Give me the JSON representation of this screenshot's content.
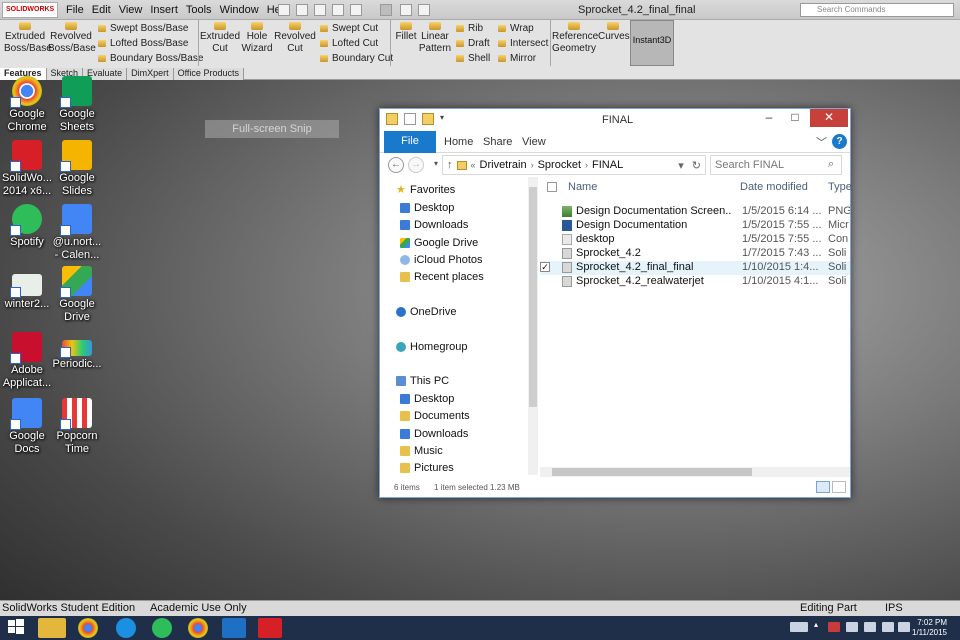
{
  "solidworks": {
    "logo": "SOLIDWORKS",
    "menu": [
      "File",
      "Edit",
      "View",
      "Insert",
      "Tools",
      "Window",
      "Help"
    ],
    "doc_title": "Sprocket_4.2_final_final",
    "search_placeholder": "Search Commands",
    "commands": {
      "extruded_boss": "Extruded\nBoss/Base",
      "revolved_boss": "Revolved\nBoss/Base",
      "swept_boss": "Swept Boss/Base",
      "lofted_boss": "Lofted Boss/Base",
      "boundary_boss": "Boundary Boss/Base",
      "extruded_cut": "Extruded\nCut",
      "hole_wizard": "Hole\nWizard",
      "revolved_cut": "Revolved\nCut",
      "swept_cut": "Swept Cut",
      "lofted_cut": "Lofted Cut",
      "boundary_cut": "Boundary Cut",
      "fillet": "Fillet",
      "linear_pattern": "Linear\nPattern",
      "rib": "Rib",
      "draft": "Draft",
      "shell": "Shell",
      "wrap": "Wrap",
      "intersect": "Intersect",
      "mirror": "Mirror",
      "reference_geometry": "Reference\nGeometry",
      "curves": "Curves",
      "instant3d": "Instant3D"
    },
    "tabs": [
      "Features",
      "Sketch",
      "Evaluate",
      "DimXpert",
      "Office Products"
    ],
    "status_left": "SolidWorks Student Edition",
    "status_mid": "Academic Use Only",
    "status_right": "Editing Part",
    "status_units": "IPS"
  },
  "desktop": {
    "snip_label": "Full-screen Snip",
    "icons": [
      {
        "label": "Google\nChrome"
      },
      {
        "label": "Google\nSheets"
      },
      {
        "label": "SolidWo...\n2014 x6..."
      },
      {
        "label": "Google\nSlides"
      },
      {
        "label": "Spotify"
      },
      {
        "label": "@u.nort...\n- Calen..."
      },
      {
        "label": "winter2..."
      },
      {
        "label": "Google\nDrive"
      },
      {
        "label": "Adobe\nApplicat..."
      },
      {
        "label": "Periodic..."
      },
      {
        "label": "Google\nDocs"
      },
      {
        "label": "Popcorn\nTime"
      }
    ]
  },
  "explorer": {
    "title": "FINAL",
    "ribbon": {
      "file": "File",
      "home": "Home",
      "share": "Share",
      "view": "View",
      "help": "?"
    },
    "breadcrumb": [
      "Drivetrain",
      "Sprocket",
      "FINAL"
    ],
    "breadcrumb_prefix": "«",
    "search_placeholder": "Search FINAL",
    "nav": {
      "favorites": "Favorites",
      "fav_items": [
        "Desktop",
        "Downloads",
        "Google Drive",
        "iCloud Photos",
        "Recent places"
      ],
      "onedrive": "OneDrive",
      "homegroup": "Homegroup",
      "thispc": "This PC",
      "pc_items": [
        "Desktop",
        "Documents",
        "Downloads",
        "Music",
        "Pictures"
      ]
    },
    "columns": {
      "name": "Name",
      "date": "Date modified",
      "type": "Type"
    },
    "files": [
      {
        "name": "Design Documentation Screen...",
        "date": "1/5/2015 6:14 ...",
        "type": "PNG"
      },
      {
        "name": "Design Documentation",
        "date": "1/5/2015 7:55 ...",
        "type": "Micr"
      },
      {
        "name": "desktop",
        "date": "1/5/2015 7:55 ...",
        "type": "Con"
      },
      {
        "name": "Sprocket_4.2",
        "date": "1/7/2015 7:43 ...",
        "type": "Soli"
      },
      {
        "name": "Sprocket_4.2_final_final",
        "date": "1/10/2015 1:4...",
        "type": "Soli"
      },
      {
        "name": "Sprocket_4.2_realwaterjet",
        "date": "1/10/2015 4:1...",
        "type": "Soli"
      }
    ],
    "status_items": "6 items",
    "status_selected": "1 item selected  1.23 MB"
  },
  "taskbar": {
    "time": "7:02 PM",
    "date": "1/11/2015"
  }
}
